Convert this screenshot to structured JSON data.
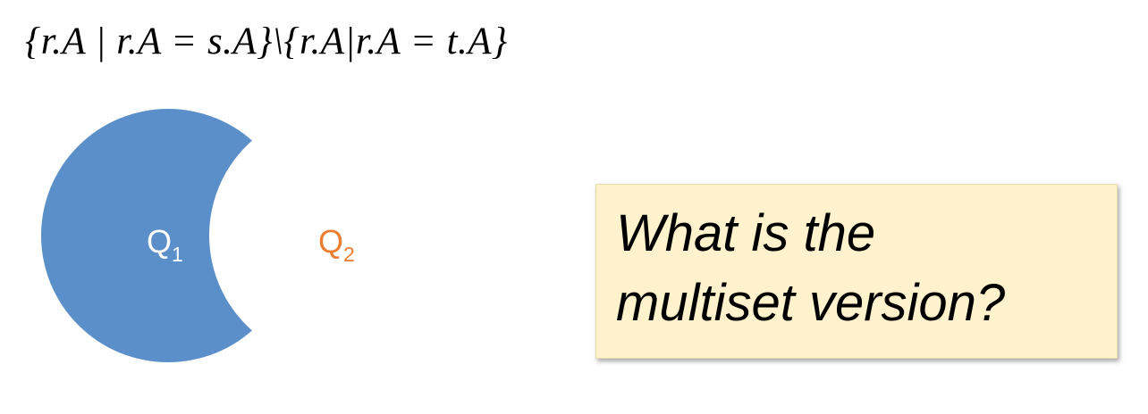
{
  "formula": "{r.A | r.A = s.A}\\{r.A|r.A = t.A}",
  "diagram": {
    "q1": {
      "base": "Q",
      "sub": "1",
      "color": "#ffffff"
    },
    "q2": {
      "base": "Q",
      "sub": "2",
      "color": "#ed7d31"
    },
    "shape_color": "#5b8fc9"
  },
  "callout": {
    "line1": "What is the",
    "line2": "multiset version?",
    "background": "#fff2cc"
  }
}
